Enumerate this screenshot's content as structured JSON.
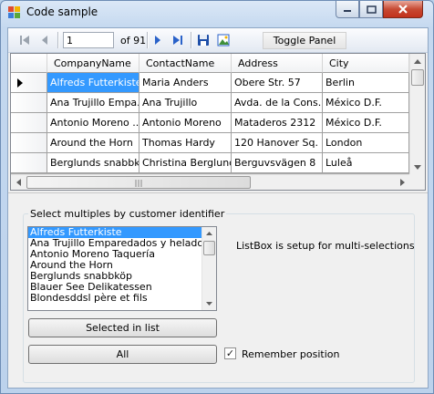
{
  "window": {
    "title": "Code sample"
  },
  "toolbar": {
    "position_value": "1",
    "count_label": "of 91",
    "toggle_label": "Toggle Panel"
  },
  "grid": {
    "columns": [
      "CompanyName",
      "ContactName",
      "Address",
      "City"
    ],
    "rows": [
      [
        "Alfreds Futterkiste",
        "Maria Anders",
        "Obere Str. 57",
        "Berlin"
      ],
      [
        "Ana Trujillo Empa...",
        "Ana Trujillo",
        "Avda. de la Cons...",
        "México D.F."
      ],
      [
        "Antonio Moreno ...",
        "Antonio Moreno",
        "Mataderos  2312",
        "México D.F."
      ],
      [
        "Around the Horn",
        "Thomas Hardy",
        "120 Hanover Sq.",
        "London"
      ],
      [
        "Berglunds snabbk...",
        "Christina Berglund",
        "Berguvsvägen  8",
        "Luleå"
      ]
    ],
    "selected_row": 0
  },
  "panel": {
    "group_title": "Select multiples by customer identifier",
    "list_items": [
      "Alfreds Futterkiste",
      "Ana Trujillo Emparedados y helados",
      "Antonio Moreno Taquería",
      "Around the Horn",
      "Berglunds snabbköp",
      "Blauer See Delikatessen",
      "Blondesddsl père et fils"
    ],
    "selected_list_index": 0,
    "note": "ListBox is setup for multi-selections",
    "selected_button": "Selected in list",
    "all_button": "All",
    "remember_label": "Remember position",
    "remember_checked": true
  },
  "colors": {
    "selection": "#3399ff",
    "close_button": "#c74a33"
  }
}
